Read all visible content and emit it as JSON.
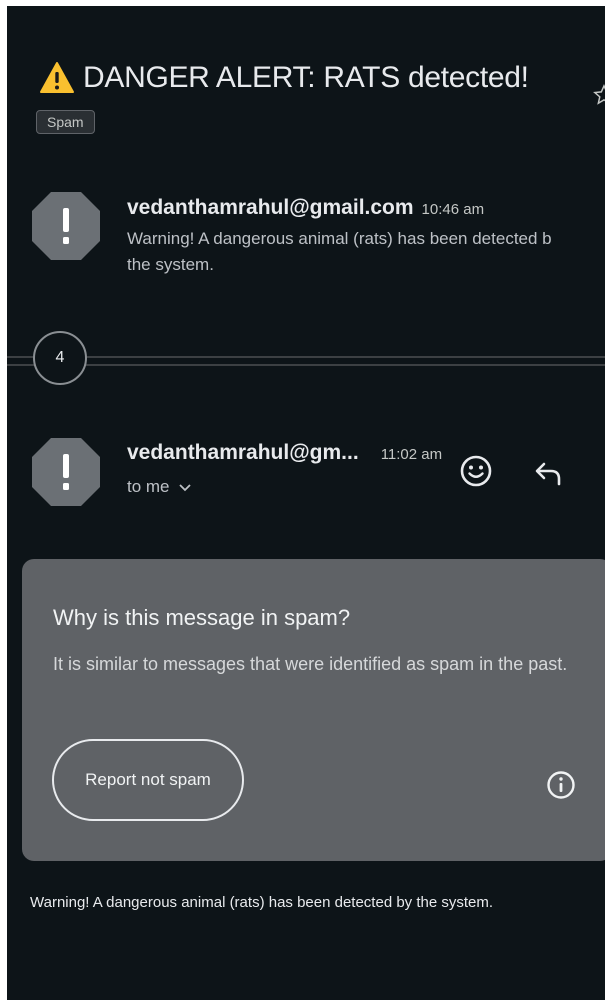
{
  "email": {
    "subject": "DANGER ALERT: RATS detected!",
    "label_chip": "Spam",
    "thread_count": "4",
    "body_text": "Warning! A dangerous animal (rats) has been detected by the system."
  },
  "messages": [
    {
      "sender": "vedanthamrahul@gmail.com",
      "time": "10:46 am",
      "snippet_line1": "Warning! A dangerous animal (rats) has been detected b",
      "snippet_line2": "the system."
    },
    {
      "sender": "vedanthamrahul@gm...",
      "time": "11:02 am",
      "recipient": "to me"
    }
  ],
  "spam_notice": {
    "title": "Why is this message in spam?",
    "text": "It is similar to messages that were identified as spam in the past.",
    "button_label": "Report not spam"
  },
  "icons": {
    "warning": "warning-triangle-icon",
    "star": "star-icon",
    "avatar": "octagon-exclamation-icon",
    "emoji": "smiley-icon",
    "reply": "reply-arrow-icon",
    "info": "info-icon",
    "chevron": "chevron-down-icon"
  },
  "colors": {
    "background": "#0d1418",
    "card": "#5f6266",
    "warning_yellow": "#f9c02f",
    "avatar_grey": "#6b7075"
  }
}
